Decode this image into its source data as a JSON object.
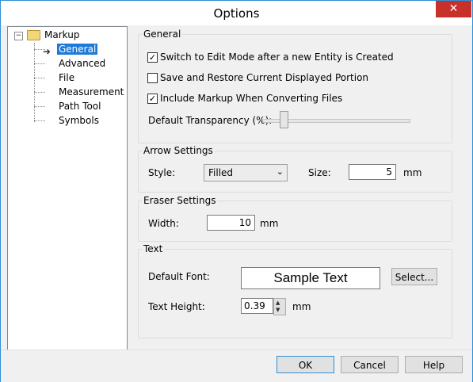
{
  "window": {
    "title": "Options",
    "close_glyph": "✕"
  },
  "tree": {
    "root": {
      "label": "Markup",
      "expander_glyph": "−"
    },
    "items": [
      {
        "label": "General",
        "selected": true
      },
      {
        "label": "Advanced"
      },
      {
        "label": "File"
      },
      {
        "label": "Measurement"
      },
      {
        "label": "Path Tool"
      },
      {
        "label": "Symbols"
      }
    ]
  },
  "general": {
    "group_label": "General",
    "options": [
      {
        "label": "Switch to Edit Mode after a new Entity is Created",
        "checked": true
      },
      {
        "label": "Save and Restore Current Displayed Portion",
        "checked": false
      },
      {
        "label": "Include Markup When  Converting Files",
        "checked": true
      }
    ],
    "transparency_label": "Default Transparency (%):",
    "transparency_level": 0.12
  },
  "arrow": {
    "group_label": "Arrow Settings",
    "style_label": "Style:",
    "style_value": "Filled",
    "size_label": "Size:",
    "size_value": "5",
    "size_unit": "mm"
  },
  "eraser": {
    "group_label": "Eraser Settings",
    "width_label": "Width:",
    "width_value": "10",
    "width_unit": "mm"
  },
  "text": {
    "group_label": "Text",
    "font_label": "Default Font:",
    "font_sample": "Sample Text",
    "select_label": "Select...",
    "height_label": "Text Height:",
    "height_value": "0.39",
    "height_unit": "mm"
  },
  "buttons": {
    "ok": "OK",
    "cancel": "Cancel",
    "help": "Help"
  }
}
